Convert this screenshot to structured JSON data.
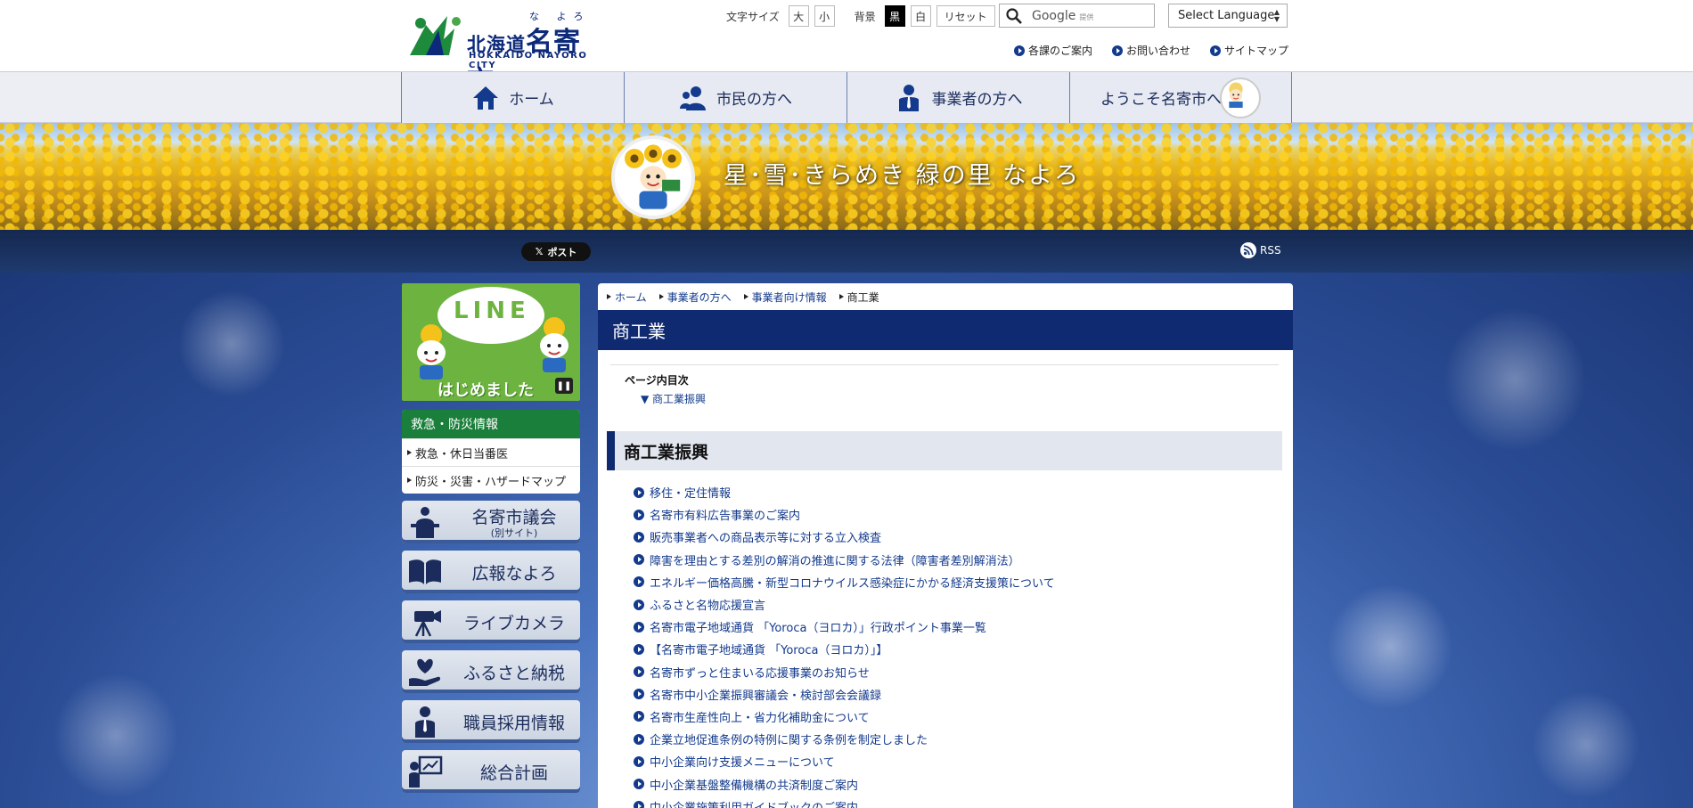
{
  "header": {
    "logo_prefix": "北海道",
    "logo_city": "名寄市",
    "logo_ruby": "な よろ",
    "logo_en": "HOKKAIDO NAYORO CITY",
    "font_size_label": "文字サイズ",
    "font_large": "大",
    "font_small": "小",
    "bg_label": "背景",
    "bg_black": "黒",
    "bg_white": "白",
    "reset": "リセット",
    "search_placeholder": "Google",
    "search_powered": "提供",
    "language": "Select Language",
    "sublinks": [
      "各課のご案内",
      "お問い合わせ",
      "サイトマップ"
    ]
  },
  "nav": {
    "items": [
      "ホーム",
      "市民の方へ",
      "事業者の方へ",
      "ようこそ名寄市へ"
    ]
  },
  "hero": {
    "title": "星･雪･きらめき 緑の里 なよろ"
  },
  "social": {
    "post": "ポスト",
    "rss": "RSS"
  },
  "sidebar": {
    "line_text": "LINE",
    "line_caption": "はじめました",
    "emergency_title": "救急・防災情報",
    "emergency_items": [
      "救急・休日当番医",
      "防災・災害・ハザードマップ"
    ],
    "buttons": [
      {
        "label": "名寄市議会",
        "sub": "(別サイト)",
        "icon": "podium-icon"
      },
      {
        "label": "広報なよろ",
        "icon": "book-icon"
      },
      {
        "label": "ライブカメラ",
        "icon": "camera-icon"
      },
      {
        "label": "ふるさと納税",
        "icon": "heart-hand-icon"
      },
      {
        "label": "職員採用情報",
        "icon": "person-icon"
      },
      {
        "label": "総合計画",
        "icon": "presentation-icon"
      }
    ]
  },
  "breadcrumb": [
    "ホーム",
    "事業者の方へ",
    "事業者向け情報",
    "商工業"
  ],
  "main": {
    "title": "商工業",
    "toc_title": "ページ内目次",
    "toc_item": "▼ 商工業振興",
    "section_title": "商工業振興",
    "links": [
      "移住・定住情報",
      "名寄市有料広告事業のご案内",
      "販売事業者への商品表示等に対する立入検査",
      "障害を理由とする差別の解消の推進に関する法律（障害者差別解消法）",
      "エネルギー価格高騰・新型コロナウイルス感染症にかかる経済支援策について",
      "ふるさと名物応援宣言",
      "名寄市電子地域通貨 「Yoroca（ヨロカ）」行政ポイント事業一覧",
      "【名寄市電子地域通貨 「Yoroca（ヨロカ）」】",
      "名寄市ずっと住まいる応援事業のお知らせ",
      "名寄市中小企業振興審議会・検討部会会議録",
      "名寄市生産性向上・省力化補助金について",
      "企業立地促進条例の特例に関する条例を制定しました",
      "中小企業向け支援メニューについて",
      "中小企業基盤整備機構の共済制度ご案内",
      "中小企業施策利用ガイドブックのご案内"
    ]
  },
  "colors": {
    "navy": "#102a72",
    "link": "#133a8c",
    "emergency_green": "#1a7f3a",
    "line_green": "#6db33f"
  }
}
